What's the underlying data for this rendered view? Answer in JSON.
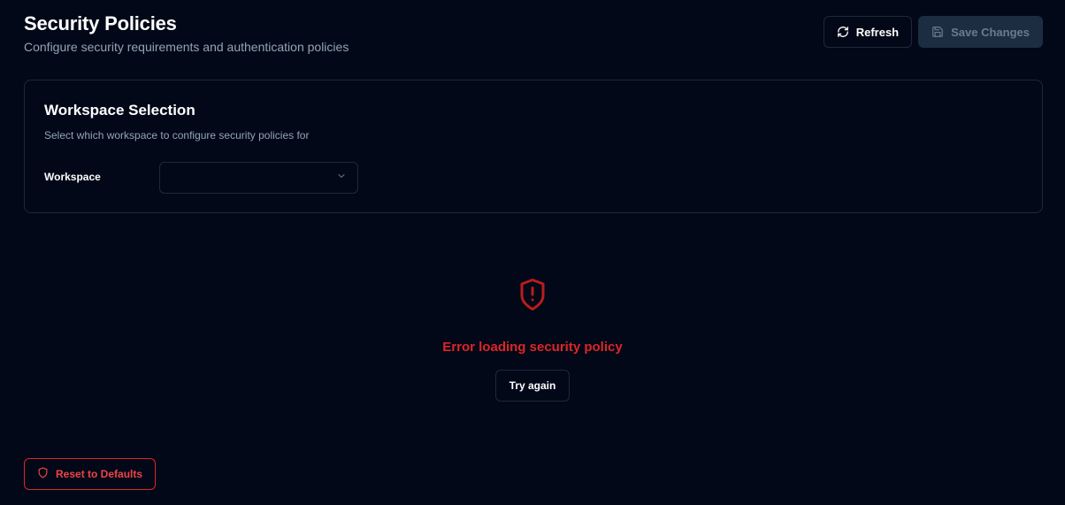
{
  "header": {
    "title": "Security Policies",
    "subtitle": "Configure security requirements and authentication policies"
  },
  "toolbar": {
    "refresh_label": "Refresh",
    "refresh_icon": "refresh-icon",
    "save_label": "Save Changes",
    "save_icon": "save-icon",
    "save_disabled": true
  },
  "workspace_card": {
    "title": "Workspace Selection",
    "description": "Select which workspace to configure security policies for",
    "field_label": "Workspace",
    "selected_value": "",
    "chevron_icon": "chevron-down-icon"
  },
  "error": {
    "icon": "shield-alert-icon",
    "message": "Error loading security policy",
    "retry_label": "Try again"
  },
  "footer": {
    "reset_label": "Reset to Defaults",
    "reset_icon": "shield-icon"
  },
  "colors": {
    "background": "#020817",
    "border": "#1e293b",
    "muted_text": "#94a3b8",
    "danger": "#dc2626",
    "save_button_bg": "#1c2d42"
  }
}
